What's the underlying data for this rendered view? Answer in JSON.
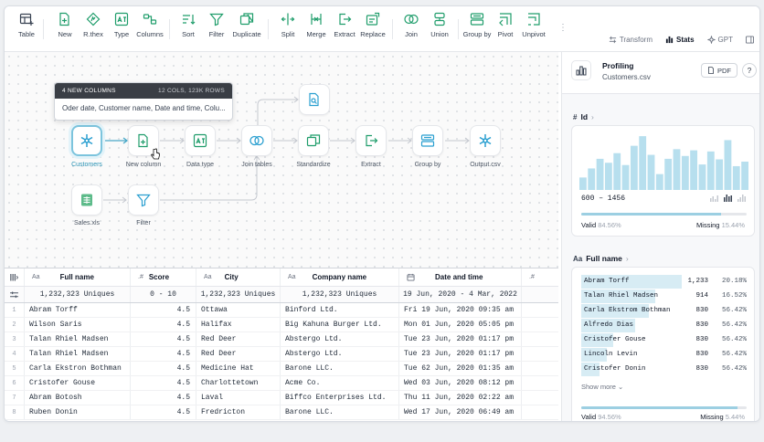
{
  "toolbar": {
    "items": [
      {
        "label": "Table",
        "icon": "table-plus-icon"
      },
      {
        "label": "New",
        "icon": "new-file-icon"
      },
      {
        "label": "R.thex",
        "icon": "regex-icon"
      },
      {
        "label": "Type",
        "icon": "type-icon"
      },
      {
        "label": "Columns",
        "icon": "columns-icon"
      },
      {
        "label": "Sort",
        "icon": "sort-icon"
      },
      {
        "label": "Filter",
        "icon": "filter-icon"
      },
      {
        "label": "Duplicate",
        "icon": "duplicate-icon"
      },
      {
        "label": "Split",
        "icon": "split-icon"
      },
      {
        "label": "Merge",
        "icon": "merge-icon"
      },
      {
        "label": "Extract",
        "icon": "extract-icon"
      },
      {
        "label": "Replace",
        "icon": "replace-icon"
      },
      {
        "label": "Join",
        "icon": "join-icon"
      },
      {
        "label": "Union",
        "icon": "union-icon"
      },
      {
        "label": "Group by",
        "icon": "group-by-icon"
      },
      {
        "label": "Pivot",
        "icon": "pivot-icon"
      },
      {
        "label": "Unpivot",
        "icon": "unpivot-icon"
      }
    ],
    "tabs": [
      {
        "label": "Transform",
        "icon": "transform-icon",
        "active": false
      },
      {
        "label": "Stats",
        "icon": "stats-icon",
        "active": true
      },
      {
        "label": "GPT",
        "icon": "gpt-icon",
        "active": false
      }
    ]
  },
  "flow": {
    "tooltip": {
      "title": "4 NEW COLUMNS",
      "meta": "12 COLS, 123K ROWS",
      "body": "Oder date, Customer name, Date and time, Colu..."
    },
    "nodes": [
      {
        "id": "customers",
        "label": "Customers",
        "icon": "snowflake-icon",
        "selected": true
      },
      {
        "id": "new_column",
        "label": "New column",
        "icon": "new-column-icon"
      },
      {
        "id": "data_type",
        "label": "Data type",
        "icon": "data-type-icon"
      },
      {
        "id": "join_tables",
        "label": "Join tables",
        "icon": "join-icon"
      },
      {
        "id": "standardize",
        "label": "Standardize",
        "icon": "standardize-icon"
      },
      {
        "id": "extract",
        "label": "Extract",
        "icon": "extract-icon"
      },
      {
        "id": "group_by",
        "label": "Group by",
        "icon": "group-by-icon"
      },
      {
        "id": "output",
        "label": "Output.csv",
        "icon": "snowflake-icon"
      },
      {
        "id": "sales",
        "label": "Sales.xls",
        "icon": "spreadsheet-icon"
      },
      {
        "id": "filter",
        "label": "Filter",
        "icon": "filter-icon"
      },
      {
        "id": "branch",
        "label": "",
        "icon": "file-search-icon"
      }
    ]
  },
  "grid": {
    "columns": [
      {
        "label": "Full name",
        "type_icon": "Aa"
      },
      {
        "label": "Score",
        "type_icon": ".#"
      },
      {
        "label": "City",
        "type_icon": "Aa"
      },
      {
        "label": "Company name",
        "type_icon": "Aa"
      },
      {
        "label": "Date and time",
        "type_icon": "calendar-icon"
      },
      {
        "label": "",
        "type_icon": ".#"
      }
    ],
    "summary": [
      "1,232,323 Uniques",
      "0 - 10",
      "1,232,323 Uniques",
      "1,232,323 Uniques",
      "19 Jun, 2020 - 4 Mar, 2022"
    ],
    "rows": [
      {
        "n": "1",
        "name": "Abram Torff",
        "score": "4.5",
        "city": "Ottawa",
        "company": "Binford Ltd.",
        "date": "Fri 19 Jun, 2020 09:35 am"
      },
      {
        "n": "2",
        "name": "Wilson Saris",
        "score": "4.5",
        "city": "Halifax",
        "company": "Big Kahuna Burger Ltd.",
        "date": "Mon 01 Jun, 2020 05:05 pm"
      },
      {
        "n": "3",
        "name": "Talan Rhiel Madsen",
        "score": "4.5",
        "city": "Red Deer",
        "company": "Abstergo Ltd.",
        "date": "Tue 23 Jun, 2020 01:17 pm"
      },
      {
        "n": "4",
        "name": "Talan Rhiel Madsen",
        "score": "4.5",
        "city": "Red Deer",
        "company": "Abstergo Ltd.",
        "date": "Tue 23 Jun, 2020 01:17 pm"
      },
      {
        "n": "5",
        "name": "Carla Ekstron Bothman",
        "score": "4.5",
        "city": "Medicine Hat",
        "company": "Barone LLC.",
        "date": "Tue 62 Jun, 2020 01:35 am"
      },
      {
        "n": "6",
        "name": "Cristofer Gouse",
        "score": "4.5",
        "city": "Charlottetown",
        "company": "Acme Co.",
        "date": "Wed 03 Jun, 2020 08:12 pm"
      },
      {
        "n": "7",
        "name": "Abram Botosh",
        "score": "4.5",
        "city": "Laval",
        "company": "Biffco Enterprises Ltd.",
        "date": "Thu 11 Jun, 2020 02:22 am"
      },
      {
        "n": "8",
        "name": "Ruben Donin",
        "score": "4.5",
        "city": "Fredricton",
        "company": "Barone LLC.",
        "date": "Wed 17 Jun, 2020 06:49 am"
      }
    ]
  },
  "profile": {
    "title": "Profiling",
    "file": "Customers.csv",
    "pdf_label": "PDF",
    "help_label": "?",
    "id_section": {
      "prefix": "#",
      "label": "Id",
      "histogram": [
        0.22,
        0.38,
        0.55,
        0.48,
        0.65,
        0.44,
        0.78,
        0.95,
        0.62,
        0.28,
        0.55,
        0.72,
        0.6,
        0.7,
        0.45,
        0.68,
        0.54,
        0.88,
        0.42,
        0.5
      ],
      "range": "600 – 1456",
      "valid_label": "Valid",
      "valid_pct": "84.56%",
      "valid_frac": 0.8456,
      "missing_label": "Missing",
      "missing_pct": "15.44%"
    },
    "name_section": {
      "prefix": "Aa",
      "label": "Full name",
      "rows": [
        {
          "name": "Abram Torff",
          "count": "1,233",
          "pct": "20.18%",
          "frac": 1.0
        },
        {
          "name": "Talan Rhiel Madsen",
          "count": "914",
          "pct": "16.52%",
          "frac": 0.74
        },
        {
          "name": "Carla Ekstrom Bothman",
          "count": "830",
          "pct": "56.42%",
          "frac": 0.67
        },
        {
          "name": "Alfredo Dias",
          "count": "830",
          "pct": "56.42%",
          "frac": 0.54
        },
        {
          "name": "Cristofer Gouse",
          "count": "830",
          "pct": "56.42%",
          "frac": 0.32
        },
        {
          "name": "Lincoln Levin",
          "count": "830",
          "pct": "56.42%",
          "frac": 0.25
        },
        {
          "name": "Cristofer Donin",
          "count": "830",
          "pct": "56.42%",
          "frac": 0.18
        }
      ],
      "show_more": "Show more",
      "valid_label": "Valid",
      "valid_pct": "94.56%",
      "valid_frac": 0.9456,
      "missing_label": "Missing",
      "missing_pct": "5.44%"
    }
  },
  "colors": {
    "accent": "#2a93b5",
    "bar": "#b7dfee",
    "bar_light": "#d7ecf4"
  }
}
